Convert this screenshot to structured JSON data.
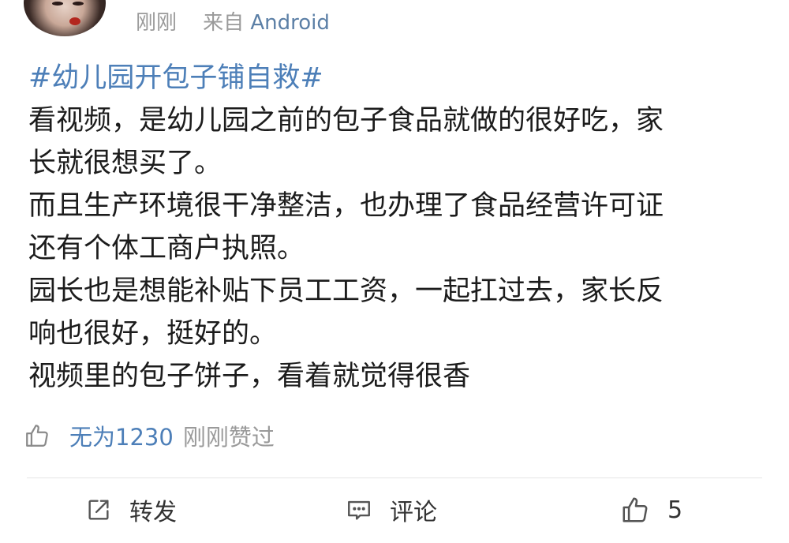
{
  "header": {
    "time": "刚刚",
    "source_prefix": "来自",
    "source_name": "Android"
  },
  "post": {
    "topic": "#幼儿园开包子铺自救#",
    "lines": [
      "看视频，是幼儿园之前的包子食品就做的很好吃，家",
      "长就很想买了。",
      "而且生产环境很干净整洁，也办理了食品经营许可证",
      "还有个体工商户执照。",
      "园长也是想能补贴下员工工资，一起扛过去，家长反",
      "响也很好，挺好的。",
      "视频里的包子饼子，看着就觉得很香"
    ]
  },
  "likes": {
    "liker_name": "无为1230",
    "liked_text": "刚刚赞过"
  },
  "actions": {
    "repost_label": "转发",
    "comment_label": "评论",
    "like_count": "5"
  },
  "colors": {
    "link_blue": "#4d7fb8",
    "meta_gray": "#9a9a9a",
    "icon_gray": "#555555"
  },
  "icons": {
    "repost": "repost-icon",
    "comment": "comment-icon",
    "like": "thumbs-up-icon"
  }
}
